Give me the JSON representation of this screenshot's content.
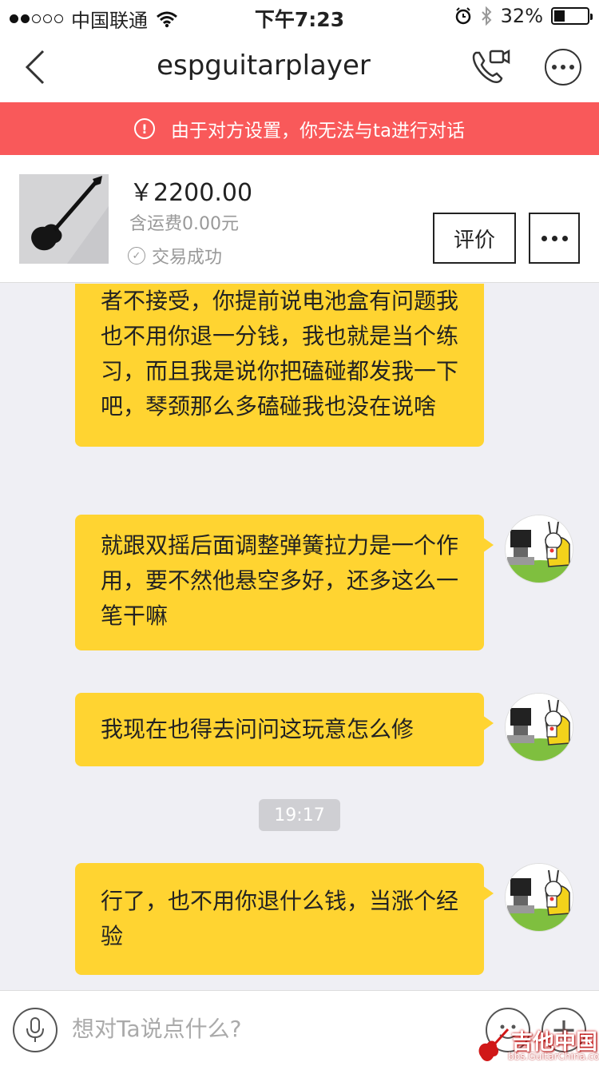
{
  "status_bar": {
    "carrier": "中国联通",
    "time": "下午7:23",
    "battery_percent": "32%",
    "battery_level": 0.32,
    "signal_bars_filled": 2,
    "signal_bars_total": 5
  },
  "nav": {
    "title": "espguitarplayer",
    "back_icon": "chevron-left-icon",
    "call_icon": "phone-video-icon",
    "more_icon": "more-dots-icon"
  },
  "banner": {
    "text": "由于对方设置，你无法与ta进行对话",
    "color": "#f9595a"
  },
  "product": {
    "price": "￥2200.00",
    "shipping": "含运费0.00元",
    "status": "交易成功",
    "rate_button": "评价"
  },
  "chat": {
    "messages": [
      "者不接受，你提前说电池盒有问题我也不用你退一分钱，我也就是当个练习，而且我是说你把磕碰都发我一下吧，琴颈那么多磕碰我也没在说啥",
      "就跟双摇后面调整弹簧拉力是一个作用，要不然他悬空多好，还多这么一笔干嘛",
      "我现在也得去问问这玩意怎么修",
      "行了，也不用你退什么钱，当涨个经验"
    ],
    "timestamp": "19:17",
    "bubble_color": "#ffd431"
  },
  "input_bar": {
    "placeholder": "想对Ta说点什么?"
  },
  "watermark": {
    "title": "吉他中国",
    "url": "bbs.GuitarChina.com"
  }
}
